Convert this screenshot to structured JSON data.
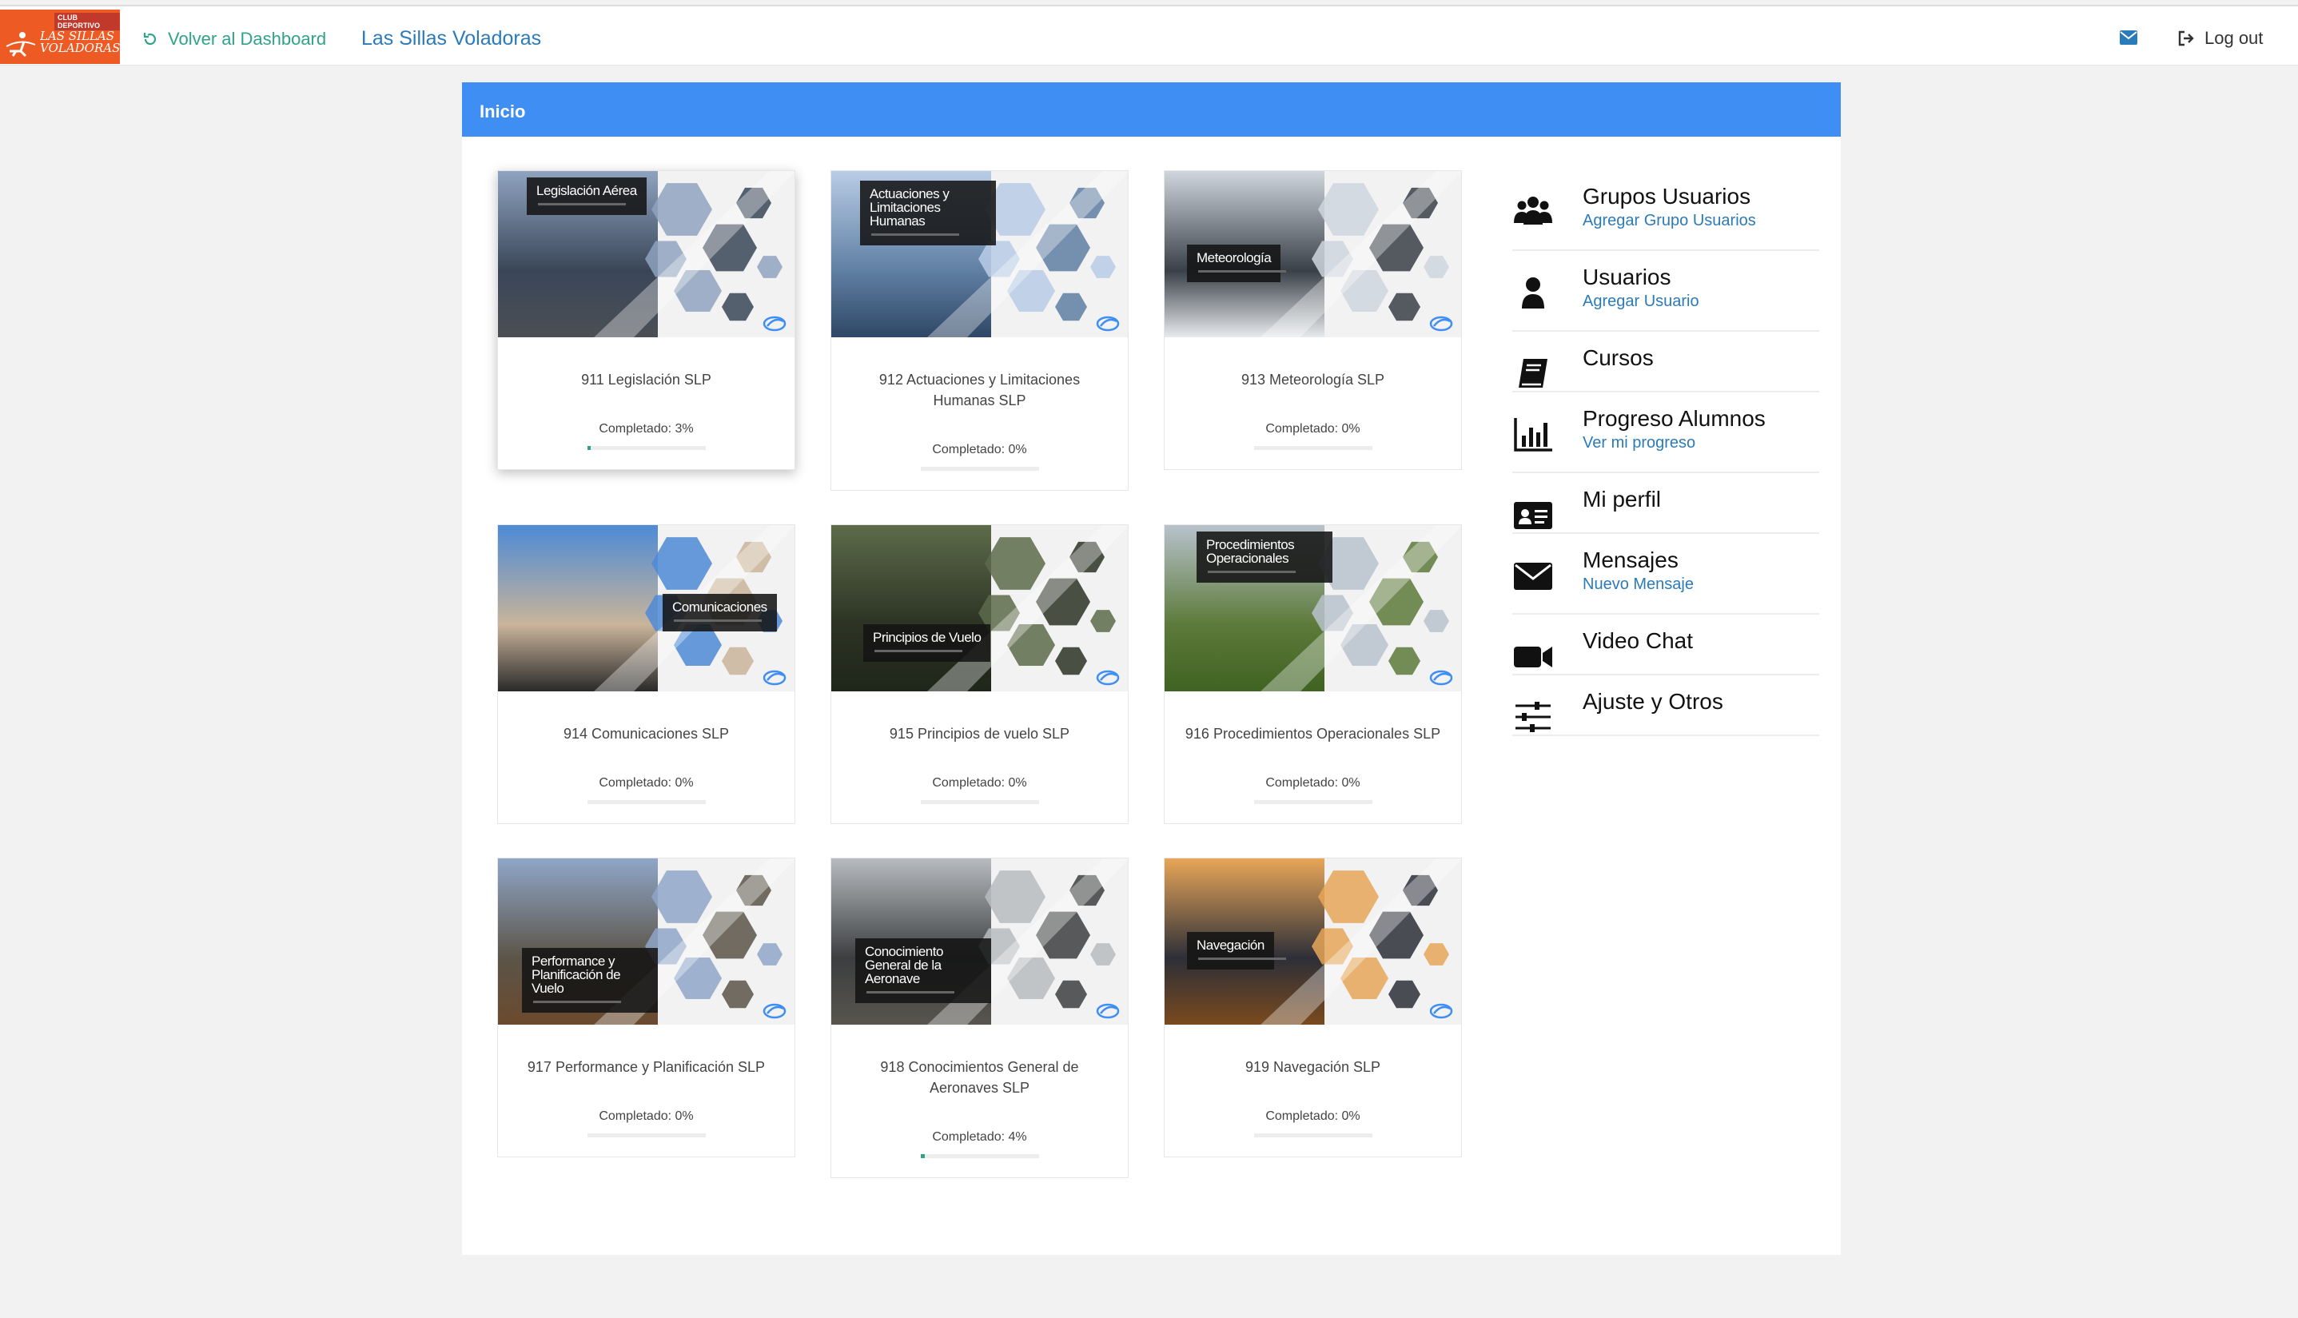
{
  "header": {
    "logo_club": "CLUB DEPORTIVO",
    "logo_brand_line1": "LAS SILLAS",
    "logo_brand_line2": "VOLADORAS",
    "back_label": "Volver al Dashboard",
    "app_title": "Las Sillas Voladoras",
    "logout_label": "Log out"
  },
  "panel": {
    "title": "Inicio"
  },
  "courses": [
    {
      "thumb_label": "Legislación Aérea",
      "title": "911 Legislación SLP",
      "progress_label": "Completado: 3%",
      "progress": 3,
      "theme": "sky"
    },
    {
      "thumb_label": "Actuaciones y Limitaciones Humanas",
      "title": "912 Actuaciones y Limitaciones Humanas SLP",
      "progress_label": "Completado: 0%",
      "progress": 0,
      "theme": "mountain"
    },
    {
      "thumb_label": "Meteorología",
      "title": "913 Meteorología SLP",
      "progress_label": "Completado: 0%",
      "progress": 0,
      "theme": "cloud"
    },
    {
      "thumb_label": "Comunicaciones",
      "title": "914 Comunicaciones SLP",
      "progress_label": "Completado: 0%",
      "progress": 0,
      "theme": "cockpit"
    },
    {
      "thumb_label": "Principios de Vuelo",
      "title": "915 Principios de vuelo SLP",
      "progress_label": "Completado: 0%",
      "progress": 0,
      "theme": "forest"
    },
    {
      "thumb_label": "Procedimientos Operacionales",
      "title": "916 Procedimientos Operacionales SLP",
      "progress_label": "Completado: 0%",
      "progress": 0,
      "theme": "field"
    },
    {
      "thumb_label": "Performance y Planificación de Vuelo",
      "title": "917 Performance y Planificación SLP",
      "progress_label": "Completado: 0%",
      "progress": 0,
      "theme": "plain"
    },
    {
      "thumb_label": "Conocimiento General de la Aeronave",
      "title": "918 Conocimientos General de Aeronaves SLP",
      "progress_label": "Completado: 4%",
      "progress": 4,
      "theme": "instrument"
    },
    {
      "thumb_label": "Navegación",
      "title": "919 Navegación SLP",
      "progress_label": "Completado: 0%",
      "progress": 0,
      "theme": "sunset"
    }
  ],
  "menu": [
    {
      "icon": "users-group-icon",
      "title": "Grupos Usuarios",
      "sub": "Agregar Grupo Usuarios"
    },
    {
      "icon": "user-icon",
      "title": "Usuarios",
      "sub": "Agregar Usuario"
    },
    {
      "icon": "book-icon",
      "title": "Cursos",
      "sub": ""
    },
    {
      "icon": "bar-chart-icon",
      "title": "Progreso Alumnos",
      "sub": "Ver mi progreso"
    },
    {
      "icon": "id-card-icon",
      "title": "Mi perfil",
      "sub": ""
    },
    {
      "icon": "envelope-icon",
      "title": "Mensajes",
      "sub": "Nuevo Mensaje"
    },
    {
      "icon": "video-camera-icon",
      "title": "Video Chat",
      "sub": ""
    },
    {
      "icon": "sliders-icon",
      "title": "Ajuste y Otros",
      "sub": ""
    }
  ],
  "colors": {
    "accent": "#3f8ef4",
    "link": "#2b7bb9",
    "success": "#2fa38a",
    "logo": "#ee5a24"
  }
}
